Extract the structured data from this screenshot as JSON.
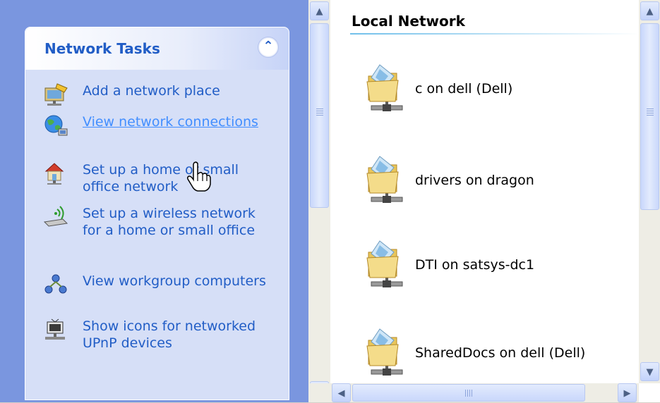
{
  "tasks_panel": {
    "title": "Network Tasks",
    "collapse_icon": "double-chevron-up-icon",
    "items": [
      {
        "label": "Add a network place",
        "icon": "network-place-icon"
      },
      {
        "label": "View network connections",
        "icon": "globe-icon",
        "hovered": true
      },
      {
        "label": "Set up a home or small office network",
        "icon": "home-network-icon"
      },
      {
        "label": "Set up a wireless network for a home or small office",
        "icon": "wireless-icon"
      },
      {
        "label": "View workgroup computers",
        "icon": "workgroup-icon"
      },
      {
        "label": "Show icons for networked UPnP devices",
        "icon": "upnp-icon"
      }
    ]
  },
  "content": {
    "title": "Local Network",
    "items": [
      {
        "label": "c on dell (Dell)",
        "icon": "network-folder-icon"
      },
      {
        "label": "drivers on dragon",
        "icon": "network-folder-icon"
      },
      {
        "label": "DTI on satsys-dc1",
        "icon": "network-folder-icon"
      },
      {
        "label": "SharedDocs on dell (Dell)",
        "icon": "network-folder-icon"
      }
    ]
  },
  "colors": {
    "task_pane_bg": "#7a96df",
    "task_box_bg": "#d6dff7",
    "task_link": "#215dc6",
    "task_link_hover": "#428eff"
  }
}
